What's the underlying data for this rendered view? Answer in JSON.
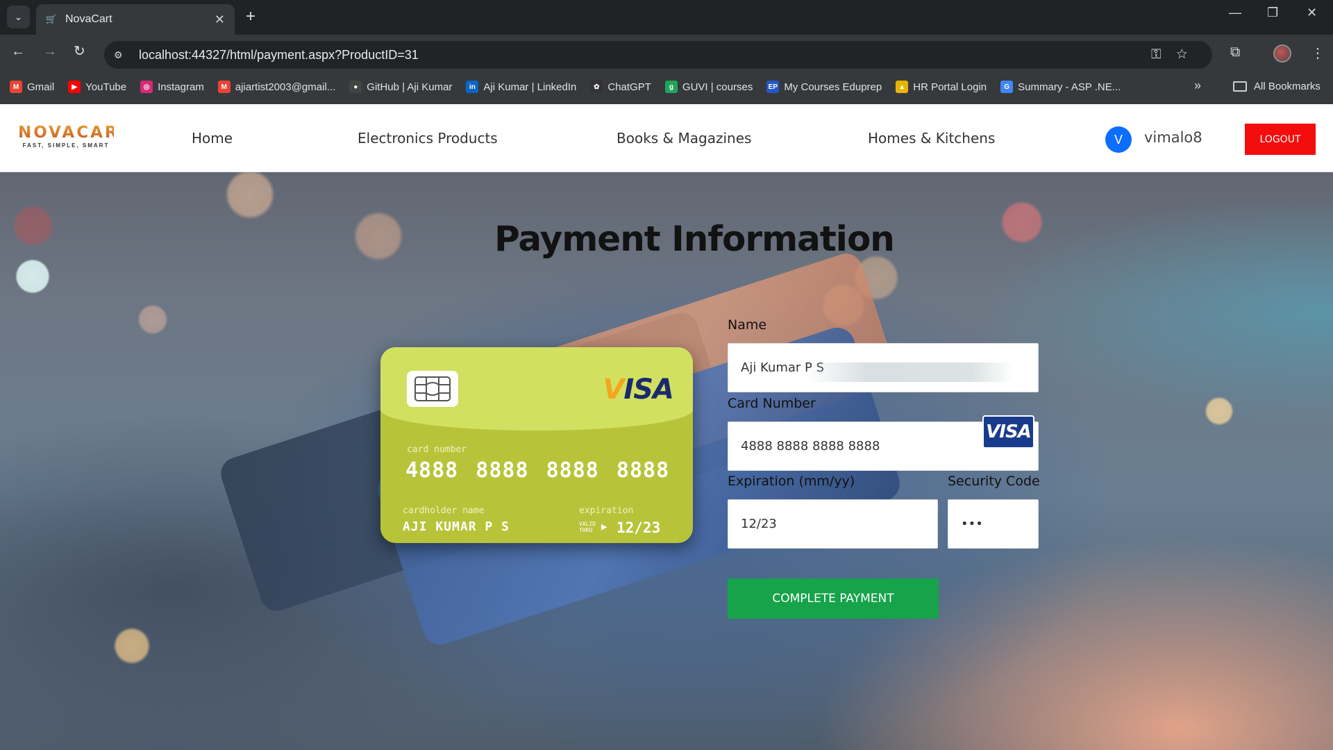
{
  "browser": {
    "tab_title": "NovaCart",
    "url": "localhost:44327/html/payment.aspx?ProductID=31",
    "bookmarks": [
      {
        "label": "Gmail",
        "icon": "gmail-icon",
        "color": "#ea4335",
        "glyph": "M"
      },
      {
        "label": "YouTube",
        "icon": "youtube-icon",
        "color": "#ff0000",
        "glyph": "▶"
      },
      {
        "label": "Instagram",
        "icon": "instagram-icon",
        "color": "#d62976",
        "glyph": "◎"
      },
      {
        "label": "ajiartist2003@gmail...",
        "icon": "gmail-icon",
        "color": "#ea4335",
        "glyph": "M"
      },
      {
        "label": "GitHub | Aji Kumar",
        "icon": "github-icon",
        "color": "#444444",
        "glyph": "●"
      },
      {
        "label": "Aji Kumar | LinkedIn",
        "icon": "linkedin-icon",
        "color": "#0a66c2",
        "glyph": "in"
      },
      {
        "label": "ChatGPT",
        "icon": "chatgpt-icon",
        "color": "#333333",
        "glyph": "✿"
      },
      {
        "label": "GUVI | courses",
        "icon": "guvi-icon",
        "color": "#22a35a",
        "glyph": "g"
      },
      {
        "label": "My Courses Eduprep",
        "icon": "eduprep-icon",
        "color": "#2457c5",
        "glyph": "EP"
      },
      {
        "label": "HR Portal Login",
        "icon": "hr-portal-icon",
        "color": "#e9b400",
        "glyph": "▲"
      },
      {
        "label": "Summary - ASP .NE...",
        "icon": "google-icon",
        "color": "#4285f4",
        "glyph": "G"
      }
    ],
    "all_bookmarks": "All Bookmarks"
  },
  "site": {
    "logo": {
      "name": "NOVACART",
      "tagline": "FAST, SIMPLE, SMART"
    },
    "nav": {
      "home": "Home",
      "electronics": "Electronics Products",
      "books": "Books & Magazines",
      "homes": "Homes & Kitchens"
    },
    "user": {
      "initial": "V",
      "name": "vimalo8"
    },
    "logout": "LOGOUT"
  },
  "payment": {
    "title": "Payment Information",
    "card": {
      "brand": "VISA",
      "number_label": "card number",
      "number": "4888 8888 8888 8888",
      "holder_label": "cardholder name",
      "holder": "AJI KUMAR P S",
      "expiry_label": "expiration",
      "valid_thru": "VALID THRU",
      "expiry": "12/23",
      "color": "#b7c43a"
    },
    "form": {
      "name_label": "Name",
      "name_value": "Aji Kumar P S",
      "card_label": "Card Number",
      "card_value": "4888 8888 8888 8888",
      "card_brand": "VISA",
      "exp_label": "Expiration (mm/yy)",
      "exp_value": "12/23",
      "cvv_label": "Security Code",
      "cvv_value": "•••",
      "submit": "COMPLETE PAYMENT"
    },
    "colors": {
      "submit": "#16a34a",
      "logout": "#f40d0d",
      "avatar": "#0d6efd"
    }
  }
}
